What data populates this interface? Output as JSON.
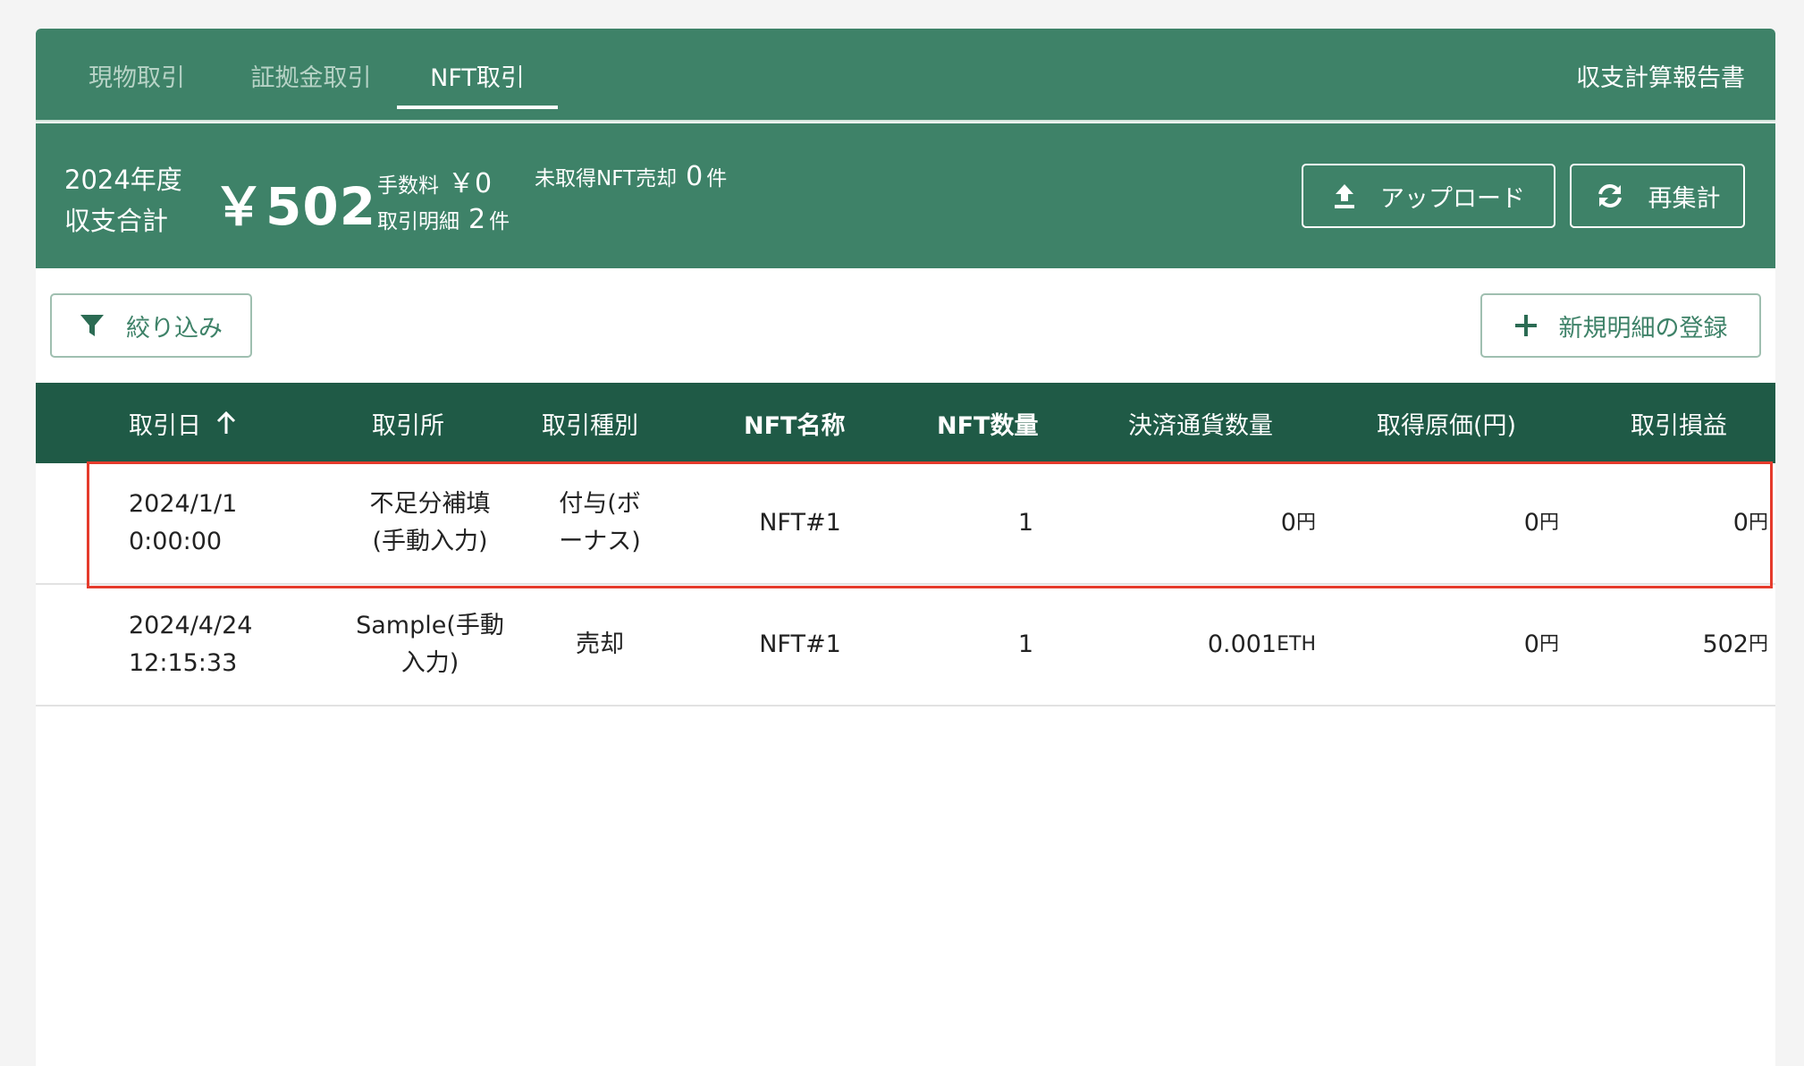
{
  "tabs": [
    {
      "label": "現物取引",
      "active": false
    },
    {
      "label": "証拠金取引",
      "active": false
    },
    {
      "label": "NFT取引",
      "active": true
    }
  ],
  "report_link": "収支計算報告書",
  "summary": {
    "fiscal_year": "2024年度",
    "total_label": "収支合計",
    "total_value": "￥502",
    "fee_label": "手数料",
    "fee_value": "￥0",
    "unacquired_label": "未取得NFT売却",
    "unacquired_count": "0",
    "unacquired_unit": "件",
    "details_label": "取引明細",
    "details_count": "2",
    "details_unit": "件"
  },
  "buttons": {
    "upload": "アップロード",
    "recalc": "再集計",
    "filter": "絞り込み",
    "new_entry": "新規明細の登録"
  },
  "table": {
    "headers": {
      "date": "取引日",
      "exchange": "取引所",
      "type": "取引種別",
      "nft_name": "NFT名称",
      "nft_qty": "NFT数量",
      "settle_qty": "決済通貨数量",
      "cost": "取得原価(円)",
      "pnl": "取引損益"
    },
    "rows": [
      {
        "date": "2024/1/1",
        "time": "0:00:00",
        "exchange_1": "不足分補填",
        "exchange_2": "(手動入力)",
        "type_1": "付与(ボ",
        "type_2": "ーナス)",
        "nft_name": "NFT#1",
        "nft_qty": "1",
        "settle_value": "0",
        "settle_unit": "円",
        "cost_value": "0",
        "cost_unit": "円",
        "pnl_value": "0",
        "pnl_unit": "円"
      },
      {
        "date": "2024/4/24",
        "time": "12:15:33",
        "exchange_1": "Sample(手動",
        "exchange_2": "入力)",
        "type_1": "売却",
        "type_2": "",
        "nft_name": "NFT#1",
        "nft_qty": "1",
        "settle_value": "0.001",
        "settle_unit": "ETH",
        "cost_value": "0",
        "cost_unit": "円",
        "pnl_value": "502",
        "pnl_unit": "円"
      }
    ]
  },
  "icons": {
    "upload": "upload-icon",
    "recalc": "refresh-icon",
    "filter": "filter-icon",
    "add": "plus-icon",
    "sort": "arrow-up-icon"
  },
  "colors": {
    "primary": "#3e8268",
    "table_header": "#1f5a46",
    "highlight": "#e53b2c"
  }
}
